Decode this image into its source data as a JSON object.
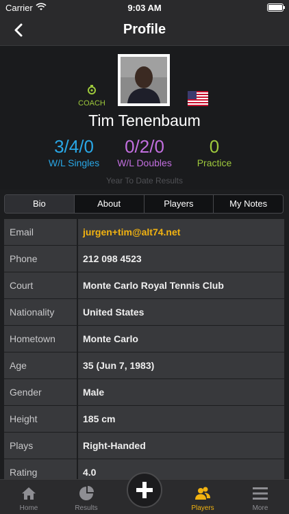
{
  "status_bar": {
    "carrier": "Carrier",
    "time": "9:03 AM"
  },
  "nav": {
    "title": "Profile"
  },
  "profile": {
    "role": "COACH",
    "name": "Tim Tenenbaum",
    "stats": {
      "singles": {
        "value": "3/4/0",
        "label": "W/L Singles",
        "color": "#29a7e6"
      },
      "doubles": {
        "value": "0/2/0",
        "label": "W/L Doubles",
        "color": "#c36fe0"
      },
      "practice": {
        "value": "0",
        "label": "Practice",
        "color": "#9ec93c"
      }
    },
    "ytd_label": "Year To Date Results"
  },
  "tabs": [
    "Bio",
    "About",
    "Players",
    "My Notes"
  ],
  "bio": [
    {
      "key": "Email",
      "value": "jurgen+tim@alt74.net"
    },
    {
      "key": "Phone",
      "value": "212 098 4523"
    },
    {
      "key": "Court",
      "value": "Monte Carlo Royal Tennis Club"
    },
    {
      "key": "Nationality",
      "value": "United States"
    },
    {
      "key": "Hometown",
      "value": "Monte Carlo"
    },
    {
      "key": "Age",
      "value": "35 (Jun 7, 1983)"
    },
    {
      "key": "Gender",
      "value": "Male"
    },
    {
      "key": "Height",
      "value": "185 cm"
    },
    {
      "key": "Plays",
      "value": "Right-Handed"
    },
    {
      "key": "Rating",
      "value": "4.0"
    }
  ],
  "tabbar": {
    "items": [
      {
        "label": "Home",
        "icon": "home-icon"
      },
      {
        "label": "Results",
        "icon": "pie-chart-icon"
      },
      {
        "label": "Players",
        "icon": "players-icon"
      },
      {
        "label": "More",
        "icon": "menu-icon"
      }
    ],
    "active": "Players",
    "accent": "#f2b311"
  }
}
